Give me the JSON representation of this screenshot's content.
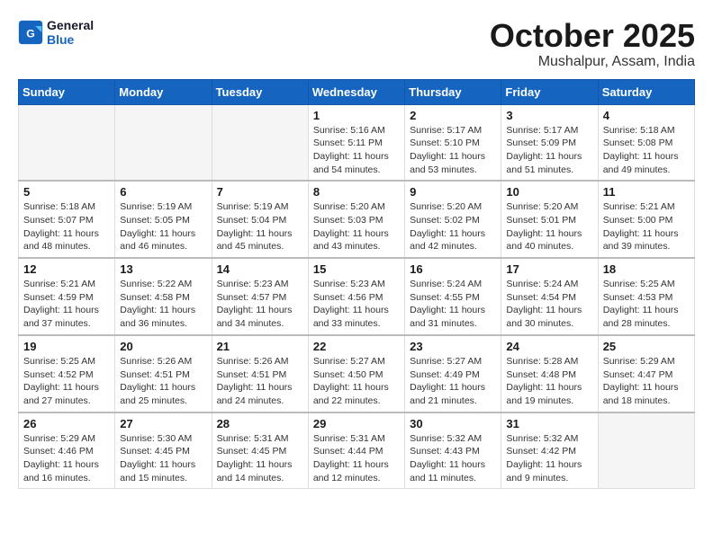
{
  "logo": {
    "line1": "General",
    "line2": "Blue"
  },
  "title": "October 2025",
  "subtitle": "Mushalpur, Assam, India",
  "weekdays": [
    "Sunday",
    "Monday",
    "Tuesday",
    "Wednesday",
    "Thursday",
    "Friday",
    "Saturday"
  ],
  "weeks": [
    [
      {
        "day": "",
        "info": ""
      },
      {
        "day": "",
        "info": ""
      },
      {
        "day": "",
        "info": ""
      },
      {
        "day": "1",
        "info": "Sunrise: 5:16 AM\nSunset: 5:11 PM\nDaylight: 11 hours\nand 54 minutes."
      },
      {
        "day": "2",
        "info": "Sunrise: 5:17 AM\nSunset: 5:10 PM\nDaylight: 11 hours\nand 53 minutes."
      },
      {
        "day": "3",
        "info": "Sunrise: 5:17 AM\nSunset: 5:09 PM\nDaylight: 11 hours\nand 51 minutes."
      },
      {
        "day": "4",
        "info": "Sunrise: 5:18 AM\nSunset: 5:08 PM\nDaylight: 11 hours\nand 49 minutes."
      }
    ],
    [
      {
        "day": "5",
        "info": "Sunrise: 5:18 AM\nSunset: 5:07 PM\nDaylight: 11 hours\nand 48 minutes."
      },
      {
        "day": "6",
        "info": "Sunrise: 5:19 AM\nSunset: 5:05 PM\nDaylight: 11 hours\nand 46 minutes."
      },
      {
        "day": "7",
        "info": "Sunrise: 5:19 AM\nSunset: 5:04 PM\nDaylight: 11 hours\nand 45 minutes."
      },
      {
        "day": "8",
        "info": "Sunrise: 5:20 AM\nSunset: 5:03 PM\nDaylight: 11 hours\nand 43 minutes."
      },
      {
        "day": "9",
        "info": "Sunrise: 5:20 AM\nSunset: 5:02 PM\nDaylight: 11 hours\nand 42 minutes."
      },
      {
        "day": "10",
        "info": "Sunrise: 5:20 AM\nSunset: 5:01 PM\nDaylight: 11 hours\nand 40 minutes."
      },
      {
        "day": "11",
        "info": "Sunrise: 5:21 AM\nSunset: 5:00 PM\nDaylight: 11 hours\nand 39 minutes."
      }
    ],
    [
      {
        "day": "12",
        "info": "Sunrise: 5:21 AM\nSunset: 4:59 PM\nDaylight: 11 hours\nand 37 minutes."
      },
      {
        "day": "13",
        "info": "Sunrise: 5:22 AM\nSunset: 4:58 PM\nDaylight: 11 hours\nand 36 minutes."
      },
      {
        "day": "14",
        "info": "Sunrise: 5:23 AM\nSunset: 4:57 PM\nDaylight: 11 hours\nand 34 minutes."
      },
      {
        "day": "15",
        "info": "Sunrise: 5:23 AM\nSunset: 4:56 PM\nDaylight: 11 hours\nand 33 minutes."
      },
      {
        "day": "16",
        "info": "Sunrise: 5:24 AM\nSunset: 4:55 PM\nDaylight: 11 hours\nand 31 minutes."
      },
      {
        "day": "17",
        "info": "Sunrise: 5:24 AM\nSunset: 4:54 PM\nDaylight: 11 hours\nand 30 minutes."
      },
      {
        "day": "18",
        "info": "Sunrise: 5:25 AM\nSunset: 4:53 PM\nDaylight: 11 hours\nand 28 minutes."
      }
    ],
    [
      {
        "day": "19",
        "info": "Sunrise: 5:25 AM\nSunset: 4:52 PM\nDaylight: 11 hours\nand 27 minutes."
      },
      {
        "day": "20",
        "info": "Sunrise: 5:26 AM\nSunset: 4:51 PM\nDaylight: 11 hours\nand 25 minutes."
      },
      {
        "day": "21",
        "info": "Sunrise: 5:26 AM\nSunset: 4:51 PM\nDaylight: 11 hours\nand 24 minutes."
      },
      {
        "day": "22",
        "info": "Sunrise: 5:27 AM\nSunset: 4:50 PM\nDaylight: 11 hours\nand 22 minutes."
      },
      {
        "day": "23",
        "info": "Sunrise: 5:27 AM\nSunset: 4:49 PM\nDaylight: 11 hours\nand 21 minutes."
      },
      {
        "day": "24",
        "info": "Sunrise: 5:28 AM\nSunset: 4:48 PM\nDaylight: 11 hours\nand 19 minutes."
      },
      {
        "day": "25",
        "info": "Sunrise: 5:29 AM\nSunset: 4:47 PM\nDaylight: 11 hours\nand 18 minutes."
      }
    ],
    [
      {
        "day": "26",
        "info": "Sunrise: 5:29 AM\nSunset: 4:46 PM\nDaylight: 11 hours\nand 16 minutes."
      },
      {
        "day": "27",
        "info": "Sunrise: 5:30 AM\nSunset: 4:45 PM\nDaylight: 11 hours\nand 15 minutes."
      },
      {
        "day": "28",
        "info": "Sunrise: 5:31 AM\nSunset: 4:45 PM\nDaylight: 11 hours\nand 14 minutes."
      },
      {
        "day": "29",
        "info": "Sunrise: 5:31 AM\nSunset: 4:44 PM\nDaylight: 11 hours\nand 12 minutes."
      },
      {
        "day": "30",
        "info": "Sunrise: 5:32 AM\nSunset: 4:43 PM\nDaylight: 11 hours\nand 11 minutes."
      },
      {
        "day": "31",
        "info": "Sunrise: 5:32 AM\nSunset: 4:42 PM\nDaylight: 11 hours\nand 9 minutes."
      },
      {
        "day": "",
        "info": ""
      }
    ]
  ]
}
